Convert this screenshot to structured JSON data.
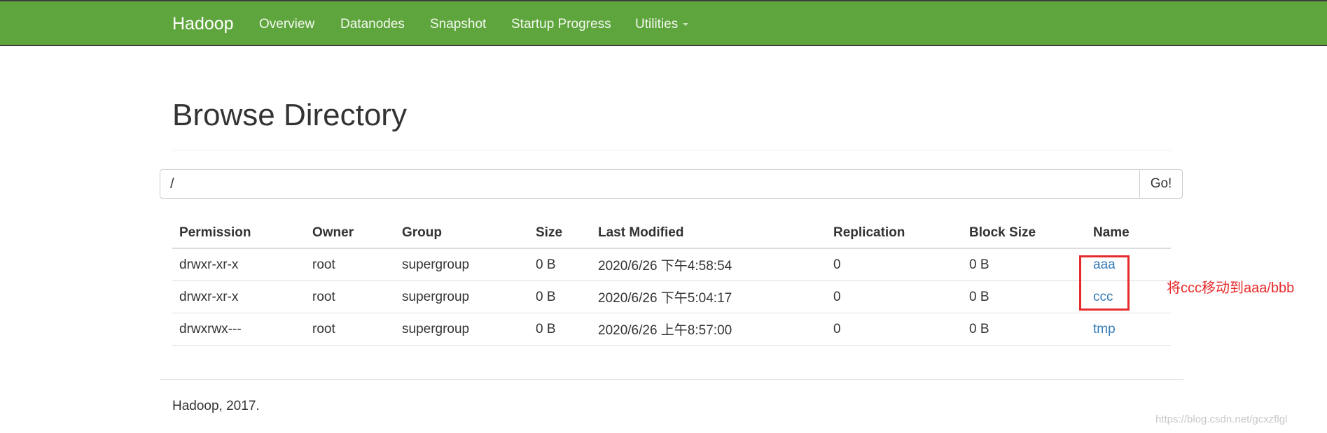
{
  "nav": {
    "brand": "Hadoop",
    "items": [
      {
        "label": "Overview"
      },
      {
        "label": "Datanodes"
      },
      {
        "label": "Snapshot"
      },
      {
        "label": "Startup Progress"
      },
      {
        "label": "Utilities"
      }
    ]
  },
  "page": {
    "title": "Browse Directory"
  },
  "path_bar": {
    "value": "/",
    "go_label": "Go!"
  },
  "table": {
    "headers": [
      "Permission",
      "Owner",
      "Group",
      "Size",
      "Last Modified",
      "Replication",
      "Block Size",
      "Name"
    ],
    "rows": [
      [
        "drwxr-xr-x",
        "root",
        "supergroup",
        "0 B",
        "2020/6/26 下午4:58:54",
        "0",
        "0 B",
        "aaa"
      ],
      [
        "drwxr-xr-x",
        "root",
        "supergroup",
        "0 B",
        "2020/6/26 下午5:04:17",
        "0",
        "0 B",
        "ccc"
      ],
      [
        "drwxrwx---",
        "root",
        "supergroup",
        "0 B",
        "2020/6/26 上午8:57:00",
        "0",
        "0 B",
        "tmp"
      ]
    ]
  },
  "annotation": "将ccc移动到aaa/bbb",
  "footer": "Hadoop, 2017.",
  "watermark": "https://blog.csdn.net/gcxzflgl",
  "colors": {
    "navbar": "#5fa53d",
    "link": "#337ab7",
    "annotation": "#e62b2b"
  }
}
